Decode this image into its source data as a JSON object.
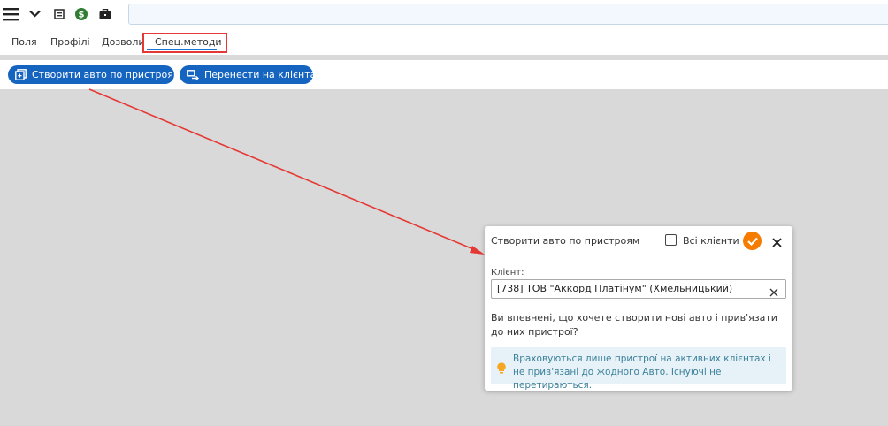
{
  "toolbar": {
    "icons": [
      "menu-icon",
      "chevron-down-icon",
      "calendar-icon",
      "dollar-icon",
      "briefcase-icon"
    ],
    "search_value": ""
  },
  "tabs": [
    {
      "label": "Поля"
    },
    {
      "label": "Профілі"
    },
    {
      "label": "Дозволи"
    },
    {
      "label": "Спец.методи",
      "active": true
    }
  ],
  "actions": {
    "create_label": "Створити авто по пристроям",
    "transfer_label": "Перенести на клієнта"
  },
  "dialog": {
    "title": "Створити авто по пристроям",
    "all_clients_label": "Всі клієнти",
    "all_clients_checked": false,
    "client_label": "Клієнт:",
    "client_value": "[738] ТОВ \"Аккорд Платінум\" (Хмельницький)",
    "question": "Ви впевнені, що хочете створити нові авто і прив'язати до них пристрої?",
    "info": "Враховуються лише пристрої на активних клієнтах і не прив'язані до жодного Авто. Існуючі не перетираються."
  },
  "colors": {
    "primary": "#1565c0",
    "accent": "#f57c00",
    "highlight": "#e53935",
    "info_bg": "#e6f2f7",
    "info_text": "#3a7f99"
  }
}
